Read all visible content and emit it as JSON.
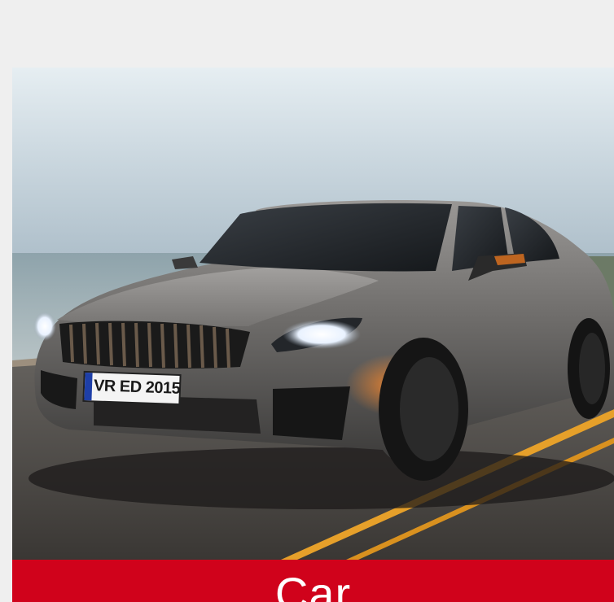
{
  "card": {
    "caption": "Car",
    "plate_text": "VR ED 2015",
    "caption_bar_color": "#d0021b",
    "background_color": "#efefef"
  }
}
